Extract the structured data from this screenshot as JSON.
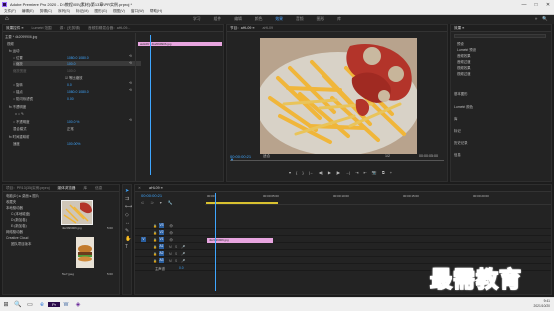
{
  "window": {
    "title": "Adobe Premiere Pro 2020 - D:\\教程\\05\\[素材]\\第13章\\PR实例.prproj *",
    "controls": [
      "—",
      "□",
      "✕"
    ]
  },
  "menu": [
    "文件(F)",
    "编辑(E)",
    "剪辑(C)",
    "序列(S)",
    "标记(M)",
    "图形(G)",
    "视图(V)",
    "窗口(W)",
    "帮助(H)"
  ],
  "workspaces": {
    "tabs": [
      "学习",
      "组件",
      "编辑",
      "颜色",
      "效果",
      "音频",
      "图形",
      "库"
    ],
    "active": 4,
    "right": [
      "»",
      "🔍"
    ]
  },
  "effect_controls": {
    "tabs": [
      "效果控件 ≡",
      "Lumetri 范围",
      "源：(无剪辑)",
      "音频剪辑混合器：aHL09..."
    ],
    "source": "主要 * 4k2099906.jpg",
    "clip_label": "aHL09 * 4k2099906.jpg",
    "rows": [
      {
        "label": "视频",
        "value": ""
      },
      {
        "label": "fx 运动",
        "value": ""
      },
      {
        "label": "○ 位置",
        "value": "1080.0   1080.0"
      },
      {
        "label": "○ 缩放",
        "value": "100.0"
      },
      {
        "label": "  缩放宽度",
        "value": "100.0"
      },
      {
        "label": "",
        "value": "☑ 等比缩放"
      },
      {
        "label": "○ 旋转",
        "value": "0.0"
      },
      {
        "label": "○ 锚点",
        "value": "1080.0   1080.0"
      },
      {
        "label": "○ 防闪烁滤镜",
        "value": "0.00"
      },
      {
        "label": "fx 不透明度",
        "value": ""
      },
      {
        "label": "",
        "value": "□ ○ ✎"
      },
      {
        "label": "○ 不透明度",
        "value": "100.0 %"
      },
      {
        "label": "  混合模式",
        "value": "正常"
      },
      {
        "label": "fx 时间重映射",
        "value": ""
      },
      {
        "label": "  速度",
        "value": "100.00%"
      }
    ]
  },
  "program": {
    "title": "节目：aHL09 ≡",
    "seq_label": "aHL09",
    "timecode": "00:00:00:21",
    "fit": "适合",
    "ratio": "1/2",
    "duration": "00:00:05:00",
    "controls": [
      "▾",
      "{",
      "}",
      "|←",
      "◀|",
      "▶",
      "|▶",
      "→|",
      "⇥",
      "⇤",
      "📷",
      "⧉",
      "+"
    ]
  },
  "project": {
    "tabs": [
      "项目：PR13(35)实例.prproj",
      "媒体浏览器",
      "库",
      "信息"
    ],
    "path": "电脑(D:) ▸ 桌面 ▸ 图片",
    "tree": [
      "收藏夹",
      "本地驱动器",
      "C:(本地磁盘)",
      "D:(新加卷)",
      "E:(新加卷)",
      "网络驱动器",
      "Creative Cloud",
      "团队项目版本"
    ],
    "thumbs": [
      {
        "name": "4k2099906.jpg",
        "dur": "5:00"
      },
      {
        "name": "5w7.jpeg",
        "dur": "5:00"
      }
    ]
  },
  "timeline": {
    "title": "aHL09 ≡",
    "timecode": "00:00:00:21",
    "ruler": [
      "00:00",
      "00:00:05:00",
      "00:00:10:00",
      "00:00:15:00",
      "00:00:20:00"
    ],
    "tracks": [
      "V3",
      "V2",
      "V1",
      "A1",
      "A2",
      "A3",
      "主声道"
    ],
    "clip": "4k2099906.jpg",
    "master_value": "0.0"
  },
  "right_panel": {
    "header": "效果 ≡",
    "items": [
      "预设",
      "Lumetri 预设",
      "音频效果",
      "音频过渡",
      "视频效果",
      "视频过渡"
    ],
    "sections": [
      "基本图形",
      "Lumetri 颜色",
      "库",
      "标记",
      "历史记录",
      "信息"
    ]
  },
  "taskbar": {
    "time": "9:41",
    "date": "2021/10/20",
    "icons": [
      "⊞",
      "🔍",
      "▭",
      "e",
      "Pr",
      "W",
      "◈"
    ]
  },
  "watermark": "最需教育"
}
